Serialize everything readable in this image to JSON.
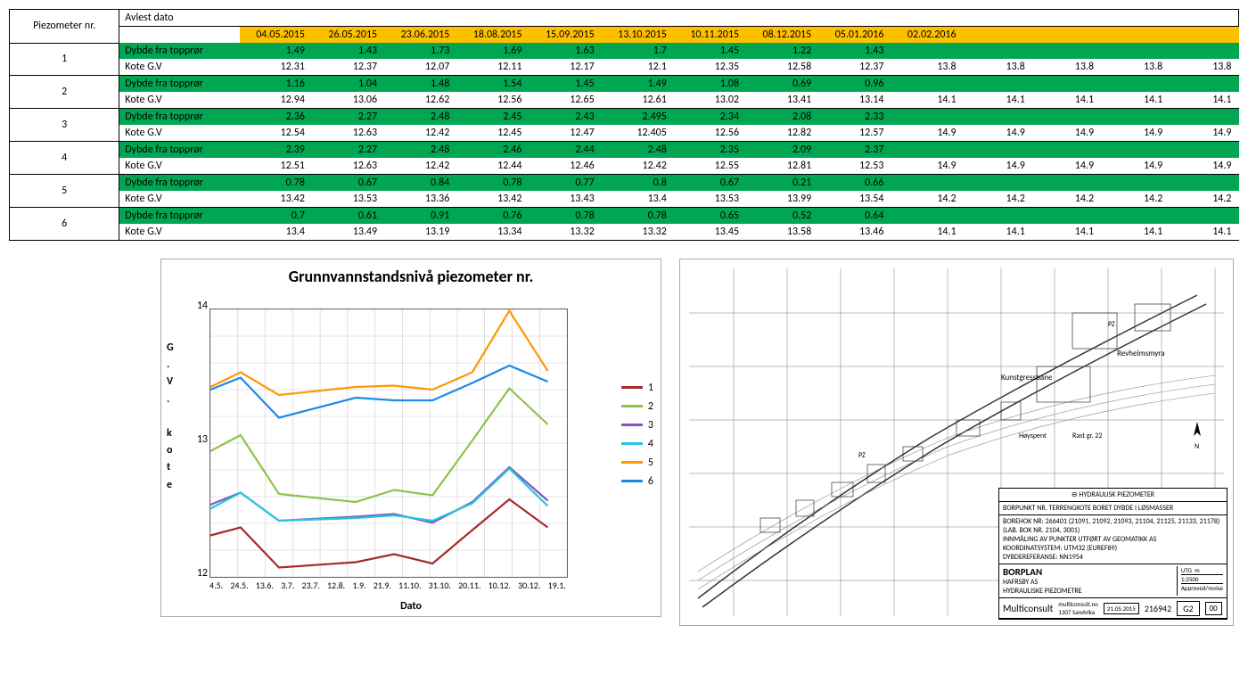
{
  "table": {
    "col_header_left": "Piezometer nr.",
    "col_header_right": "Avlest dato",
    "dates": [
      "04.05.2015",
      "26.05.2015",
      "23.06.2015",
      "18.08.2015",
      "15.09.2015",
      "13.10.2015",
      "10.11.2015",
      "08.12.2015",
      "05.01.2016",
      "02.02.2016"
    ],
    "row_labels": [
      "Dybde fra topprør",
      "Kote G.V"
    ],
    "rows": [
      {
        "pz": "1",
        "dyb": [
          "1.49",
          "1.43",
          "1.73",
          "1.69",
          "1.63",
          "1.7",
          "1.45",
          "1.22",
          "1.43",
          "",
          "",
          "",
          "",
          ""
        ],
        "kote": [
          "12.31",
          "12.37",
          "12.07",
          "12.11",
          "12.17",
          "12.1",
          "12.35",
          "12.58",
          "12.37",
          "13.8",
          "13.8",
          "13.8",
          "13.8",
          "13.8"
        ]
      },
      {
        "pz": "2",
        "dyb": [
          "1.16",
          "1.04",
          "1.48",
          "1.54",
          "1.45",
          "1.49",
          "1.08",
          "0.69",
          "0.96",
          "",
          "",
          "",
          "",
          ""
        ],
        "kote": [
          "12.94",
          "13.06",
          "12.62",
          "12.56",
          "12.65",
          "12.61",
          "13.02",
          "13.41",
          "13.14",
          "14.1",
          "14.1",
          "14.1",
          "14.1",
          "14.1"
        ]
      },
      {
        "pz": "3",
        "dyb": [
          "2.36",
          "2.27",
          "2.48",
          "2.45",
          "2.43",
          "2.495",
          "2.34",
          "2.08",
          "2.33",
          "",
          "",
          "",
          "",
          ""
        ],
        "kote": [
          "12.54",
          "12.63",
          "12.42",
          "12.45",
          "12.47",
          "12.405",
          "12.56",
          "12.82",
          "12.57",
          "14.9",
          "14.9",
          "14.9",
          "14.9",
          "14.9"
        ]
      },
      {
        "pz": "4",
        "dyb": [
          "2.39",
          "2.27",
          "2.48",
          "2.46",
          "2.44",
          "2.48",
          "2.35",
          "2.09",
          "2.37",
          "",
          "",
          "",
          "",
          ""
        ],
        "kote": [
          "12.51",
          "12.63",
          "12.42",
          "12.44",
          "12.46",
          "12.42",
          "12.55",
          "12.81",
          "12.53",
          "14.9",
          "14.9",
          "14.9",
          "14.9",
          "14.9"
        ]
      },
      {
        "pz": "5",
        "dyb": [
          "0.78",
          "0.67",
          "0.84",
          "0.78",
          "0.77",
          "0.8",
          "0.67",
          "0.21",
          "0.66",
          "",
          "",
          "",
          "",
          ""
        ],
        "kote": [
          "13.42",
          "13.53",
          "13.36",
          "13.42",
          "13.43",
          "13.4",
          "13.53",
          "13.99",
          "13.54",
          "14.2",
          "14.2",
          "14.2",
          "14.2",
          "14.2"
        ]
      },
      {
        "pz": "6",
        "dyb": [
          "0.7",
          "0.61",
          "0.91",
          "0.76",
          "0.78",
          "0.78",
          "0.65",
          "0.52",
          "0.64",
          "",
          "",
          "",
          "",
          ""
        ],
        "kote": [
          "13.4",
          "13.49",
          "13.19",
          "13.34",
          "13.32",
          "13.32",
          "13.45",
          "13.58",
          "13.46",
          "14.1",
          "14.1",
          "14.1",
          "14.1",
          "14.1"
        ]
      }
    ]
  },
  "chart_data": {
    "type": "line",
    "title": "Grunnvannstandsnivå piezometer nr.",
    "xlabel": "Dato",
    "ylabel": "G.V. kote",
    "ylim": [
      12,
      14
    ],
    "yticks": [
      12,
      13,
      14
    ],
    "x_ticks": [
      "4.5.",
      "24.5.",
      "13.6.",
      "3.7.",
      "23.7.",
      "12.8.",
      "1.9.",
      "21.9.",
      "11.10.",
      "31.10.",
      "20.11.",
      "10.12.",
      "30.12.",
      "19.1."
    ],
    "x_labels": [
      "04.05",
      "26.05",
      "23.06",
      "18.08",
      "15.09",
      "13.10",
      "10.11",
      "08.12",
      "05.01"
    ],
    "series": [
      {
        "name": "1",
        "color": "#A52A2A",
        "values": [
          12.31,
          12.37,
          12.07,
          12.11,
          12.17,
          12.1,
          12.35,
          12.58,
          12.37
        ]
      },
      {
        "name": "2",
        "color": "#8BC34A",
        "values": [
          12.94,
          13.06,
          12.62,
          12.56,
          12.65,
          12.61,
          13.02,
          13.41,
          13.14
        ]
      },
      {
        "name": "3",
        "color": "#7E57C2",
        "values": [
          12.54,
          12.63,
          12.42,
          12.45,
          12.47,
          12.405,
          12.56,
          12.82,
          12.57
        ]
      },
      {
        "name": "4",
        "color": "#26C6DA",
        "values": [
          12.51,
          12.63,
          12.42,
          12.44,
          12.46,
          12.42,
          12.55,
          12.81,
          12.53
        ]
      },
      {
        "name": "5",
        "color": "#FF9800",
        "values": [
          13.42,
          13.53,
          13.36,
          13.42,
          13.43,
          13.4,
          13.53,
          13.99,
          13.54
        ]
      },
      {
        "name": "6",
        "color": "#1E88E5",
        "values": [
          13.4,
          13.49,
          13.19,
          13.34,
          13.32,
          13.32,
          13.45,
          13.58,
          13.46
        ]
      }
    ]
  },
  "map": {
    "header_top": "HYDRAULISK PIEZOMETER",
    "header_row": "BORPUNKT NR.    TERRENGKOTE    BORET DYBDE I LØSMASSER",
    "borehole_line": "BOREHOK NR: 266401 (21091, 21092, 21093, 21104, 21125, 21133, 21178)",
    "lab_line": "(LAB. BOK NR. 2104, 3001)",
    "inn_line": "INNMÅLING AV PUNKTER UTFØRT AV GEOMATIKK AS",
    "coord_line": "KOORDINATSYSTEM: UTM32 (EUREF89)",
    "ref_line": "DYBDEREFERANSE: NN1954",
    "plan_title": "BORPLAN",
    "client": "HAFRSBY AS",
    "subtitle": "HYDRAULISKE PIEZOMETRE",
    "company": "Multiconsult",
    "date": "21.05.2015",
    "drawing_no": "216942",
    "sheet": "G2",
    "rev": "00",
    "scale": "1:2500",
    "labels": [
      "Revheimsmyra",
      "Kunstgressbane",
      "Høyspent",
      "Rast gr. 22",
      "PZ"
    ]
  }
}
